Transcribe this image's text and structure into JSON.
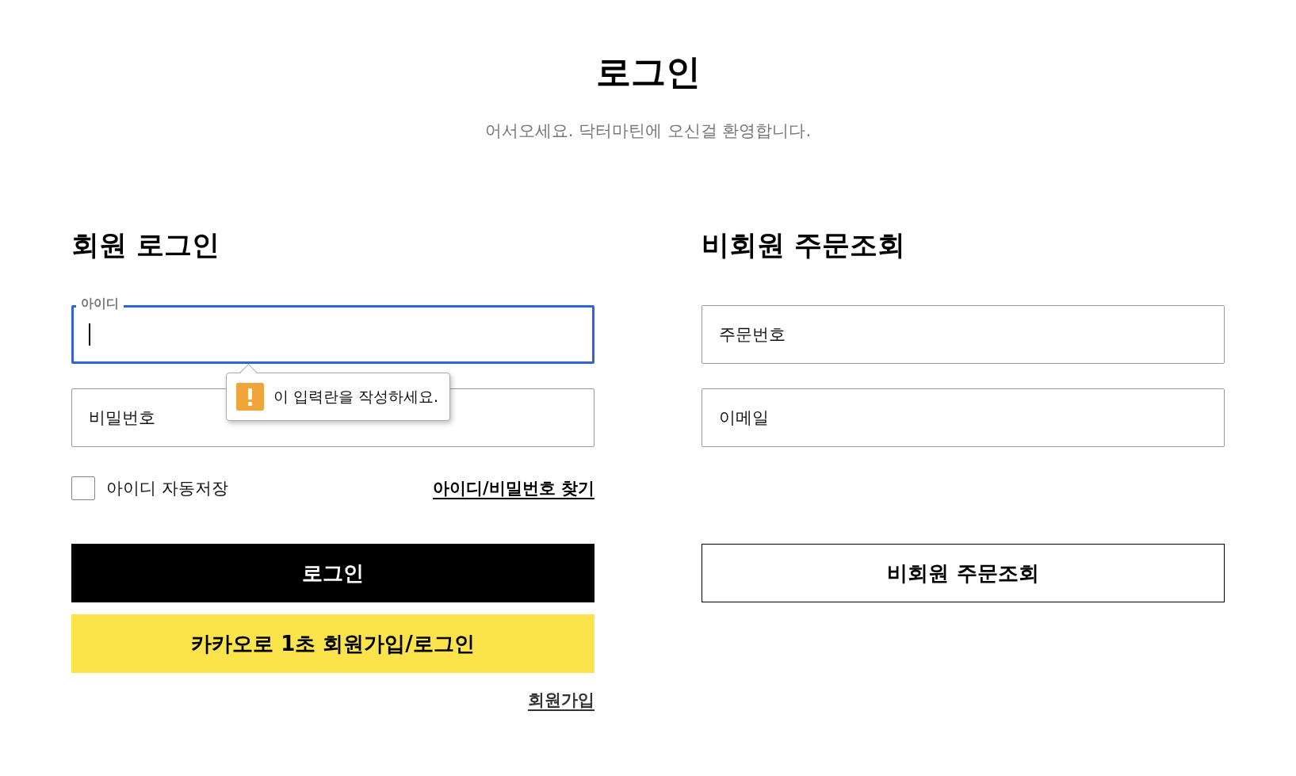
{
  "page": {
    "title": "로그인",
    "subtitle": "어서오세요. 닥터마틴에 오신걸 환영합니다."
  },
  "member_login": {
    "heading": "회원 로그인",
    "fields": [
      {
        "placeholder": "아이디",
        "focused": true,
        "tooltip": "이 입력란을 작성하세요."
      },
      {
        "placeholder": "비밀번호",
        "focused": false
      }
    ],
    "remember_id": {
      "label": "아이디 자동저장",
      "checked": false
    },
    "find_link": "아이디/비밀번호 찾기",
    "buttons": [
      {
        "kind": "primary",
        "label": "로그인"
      },
      {
        "kind": "kakao",
        "label": "카카오로 1초 회원가입/로그인"
      }
    ],
    "signup_link": "회원가입"
  },
  "guest_lookup": {
    "heading": "비회원 주문조회",
    "fields": [
      {
        "placeholder": "주문번호",
        "focused": false
      },
      {
        "placeholder": "이메일",
        "focused": false
      }
    ],
    "buttons": [
      {
        "kind": "outline",
        "label": "비회원 주문조회"
      }
    ]
  }
}
